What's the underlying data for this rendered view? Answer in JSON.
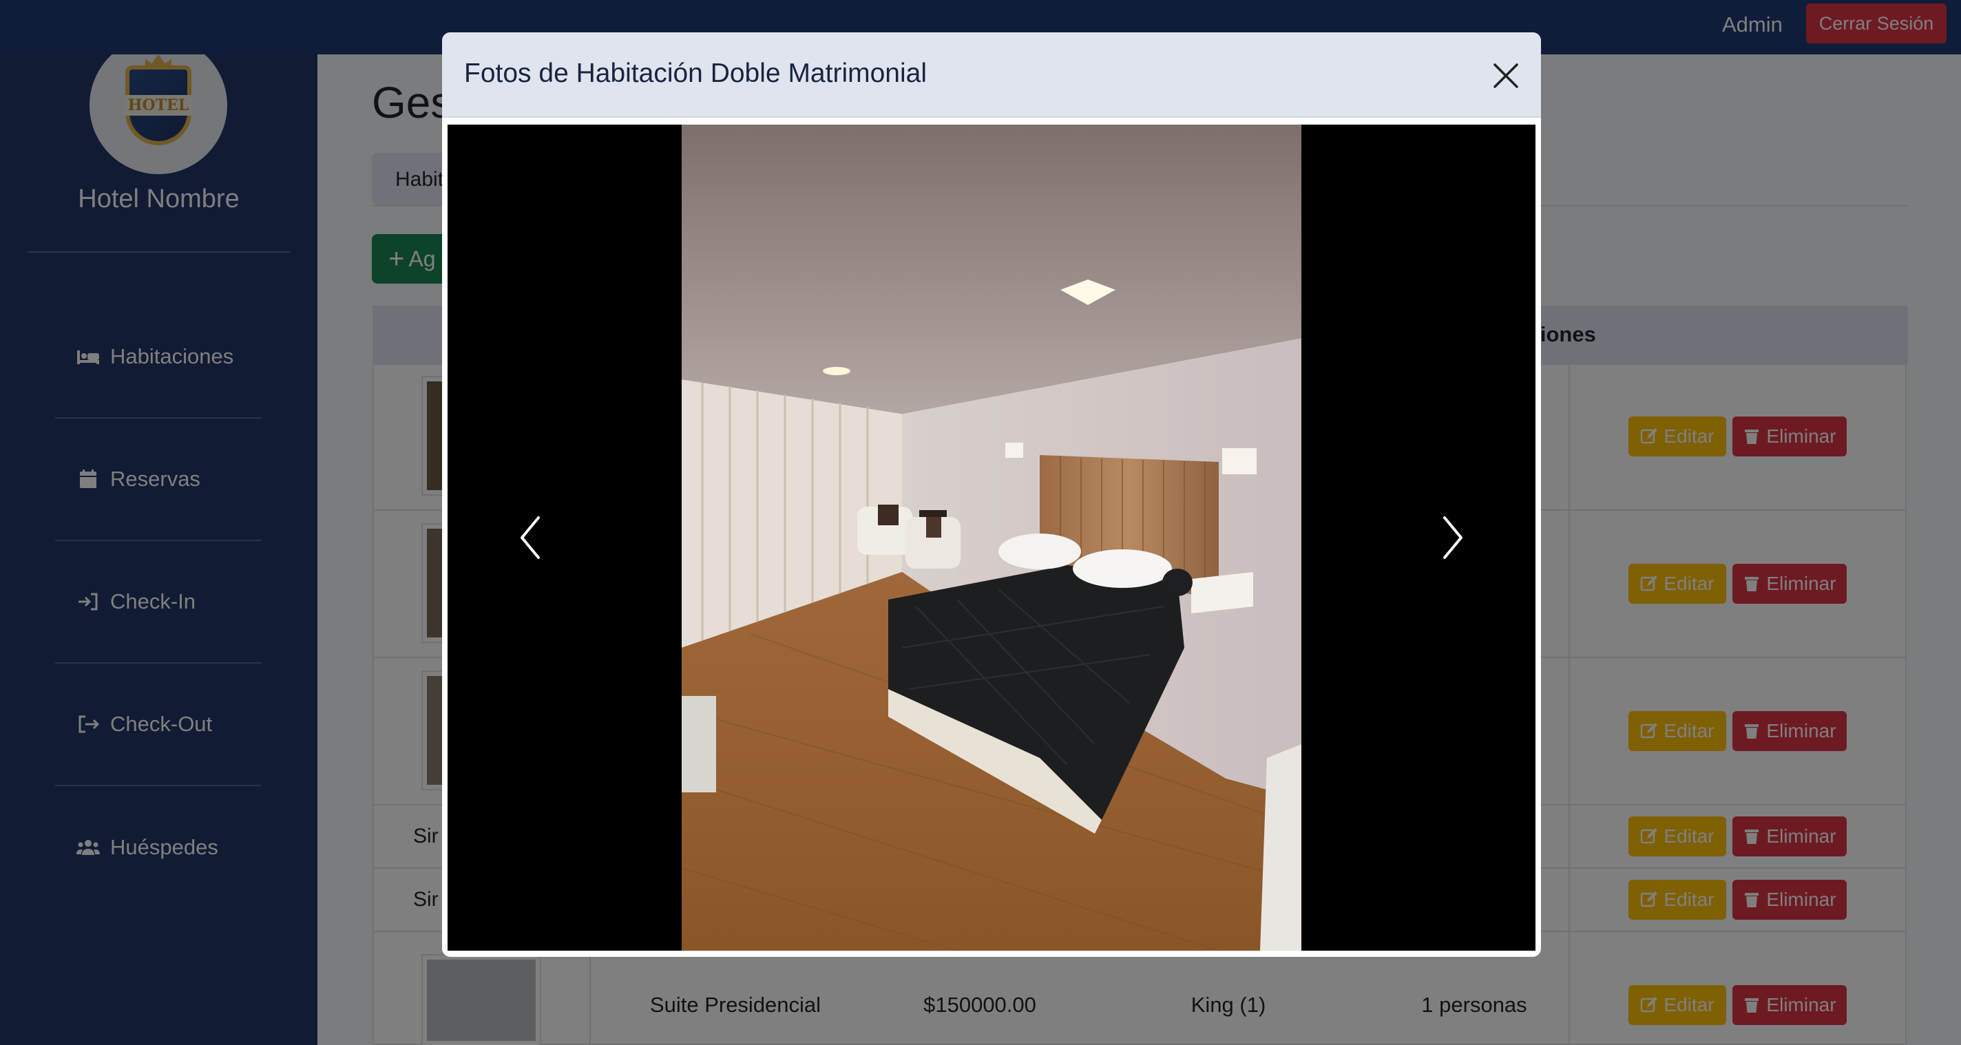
{
  "topbar": {
    "user": "Admin",
    "logout_label": "Cerrar Sesión"
  },
  "sidebar": {
    "hotel_name": "Hotel Nombre",
    "logo_text": "HOTEL",
    "items": [
      {
        "label": "Habitaciones",
        "icon": "bed-icon"
      },
      {
        "label": "Reservas",
        "icon": "calendar-icon"
      },
      {
        "label": "Check-In",
        "icon": "sign-in-icon"
      },
      {
        "label": "Check-Out",
        "icon": "sign-out-icon"
      },
      {
        "label": "Huéspedes",
        "icon": "users-icon"
      }
    ]
  },
  "main": {
    "title_fragment": "Ges",
    "tab_fragment": "Habit",
    "add_fragment": "Ag",
    "actions_header": "Acciones",
    "edit_label": "Editar",
    "delete_label": "Eliminar",
    "row_fragments": [
      "Sir",
      "Sir"
    ],
    "last_row": {
      "name": "Suite Presidencial",
      "price": "$150000.00",
      "bed": "King (1)",
      "capacity": "1 personas"
    }
  },
  "modal": {
    "title": "Fotos de Habitación Doble Matrimonial",
    "photo_alt": "Habitación con cama doble, mesas de luz y sillones",
    "prev_label": "Anterior",
    "next_label": "Siguiente"
  },
  "colors": {
    "topbar": "#1e3a74",
    "sidebar": "#223768",
    "edit": "#ffc107",
    "delete": "#dc3545",
    "add": "#198754",
    "modal_header": "#dfe4ef"
  }
}
